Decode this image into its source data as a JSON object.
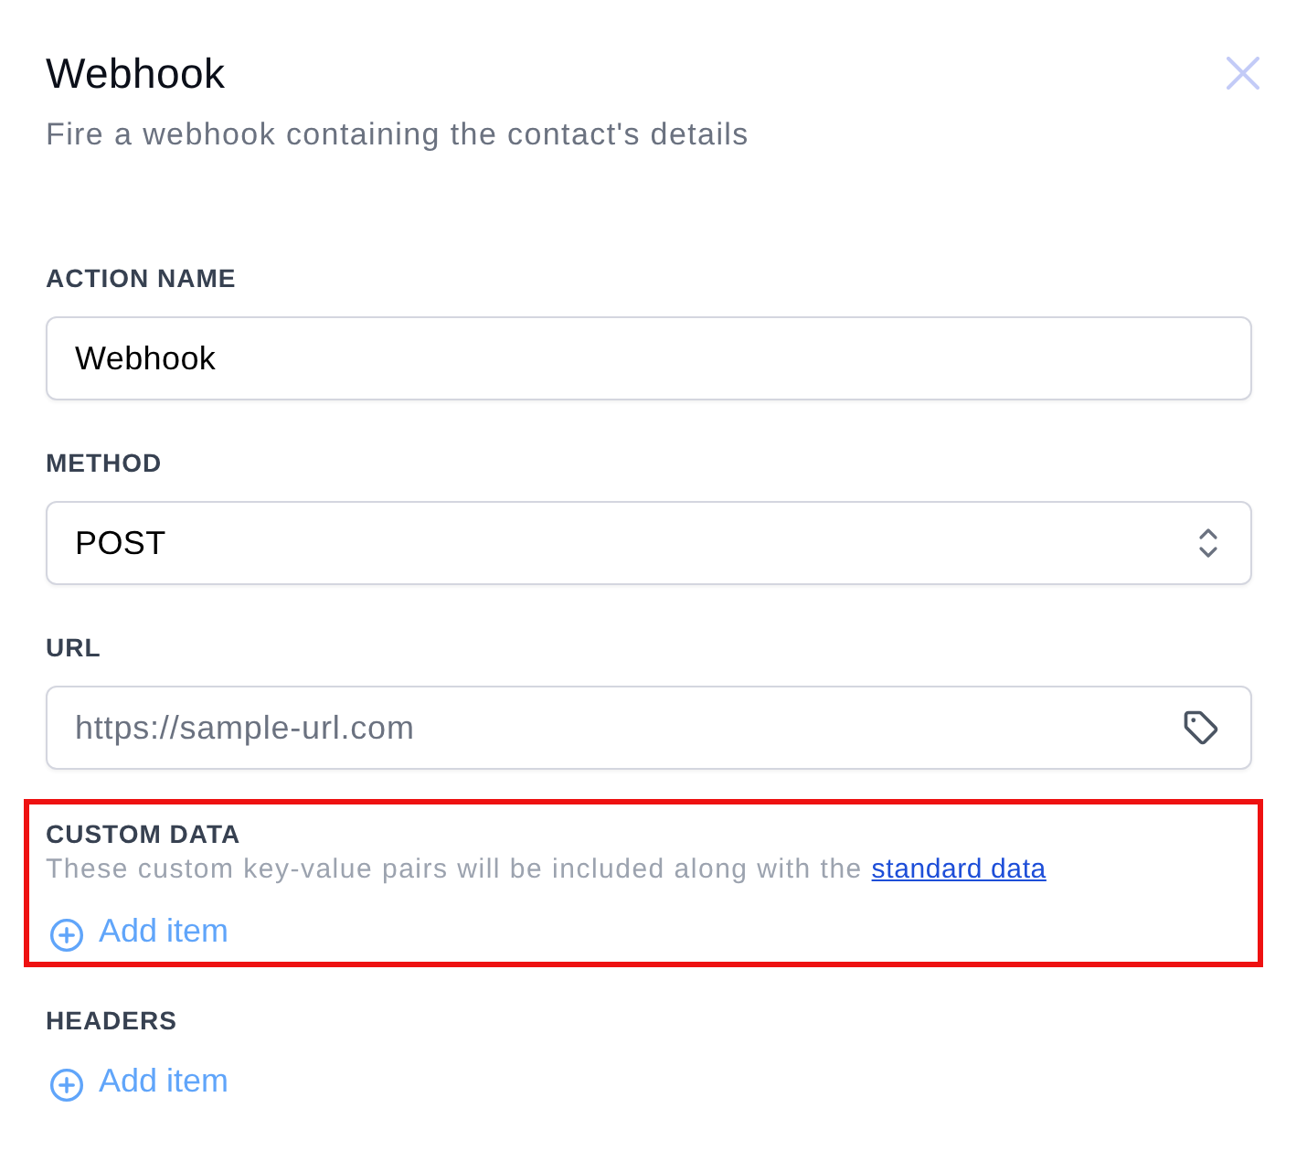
{
  "dialog": {
    "title": "Webhook",
    "subtitle": "Fire a webhook containing the contact's details"
  },
  "fields": [
    {
      "kind": "text",
      "label": "ACTION NAME",
      "value": "Webhook"
    },
    {
      "kind": "select",
      "label": "METHOD",
      "value": "POST"
    },
    {
      "kind": "tag_text",
      "label": "URL",
      "placeholder": "https://sample-url.com"
    }
  ],
  "sections": [
    {
      "label": "CUSTOM DATA",
      "description": "These custom key-value pairs will be included along with the",
      "link": "standard data",
      "add_label": "Add item",
      "highlighted": true
    },
    {
      "label": "HEADERS",
      "add_label": "Add item",
      "highlighted": false
    }
  ]
}
